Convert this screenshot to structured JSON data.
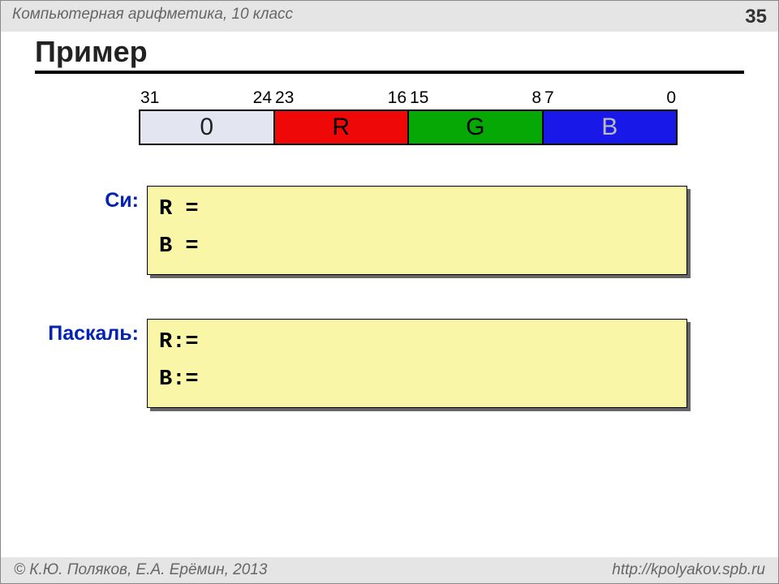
{
  "header": {
    "course": "Компьютерная арифметика, 10 класс",
    "page": "35"
  },
  "title": "Пример",
  "bitfield": {
    "labels": [
      {
        "left": "31",
        "right": "24"
      },
      {
        "left": "23",
        "right": "16"
      },
      {
        "left": "15",
        "right": "8"
      },
      {
        "left": "7",
        "right": "0"
      }
    ],
    "cells": [
      "0",
      "R",
      "G",
      "B"
    ],
    "colors": {
      "zero": "#e3e6f0",
      "R": "#ee0808",
      "G": "#06a806",
      "B": "#1818e8"
    }
  },
  "examples": {
    "c": {
      "label": "Си:",
      "lines": [
        "R =",
        "B ="
      ]
    },
    "pascal": {
      "label": "Паскаль:",
      "lines": [
        "R:=",
        "B:="
      ]
    }
  },
  "footer": {
    "authors": "© К.Ю. Поляков, Е.А. Ерёмин, 2013",
    "url": "http://kpolyakov.spb.ru"
  }
}
